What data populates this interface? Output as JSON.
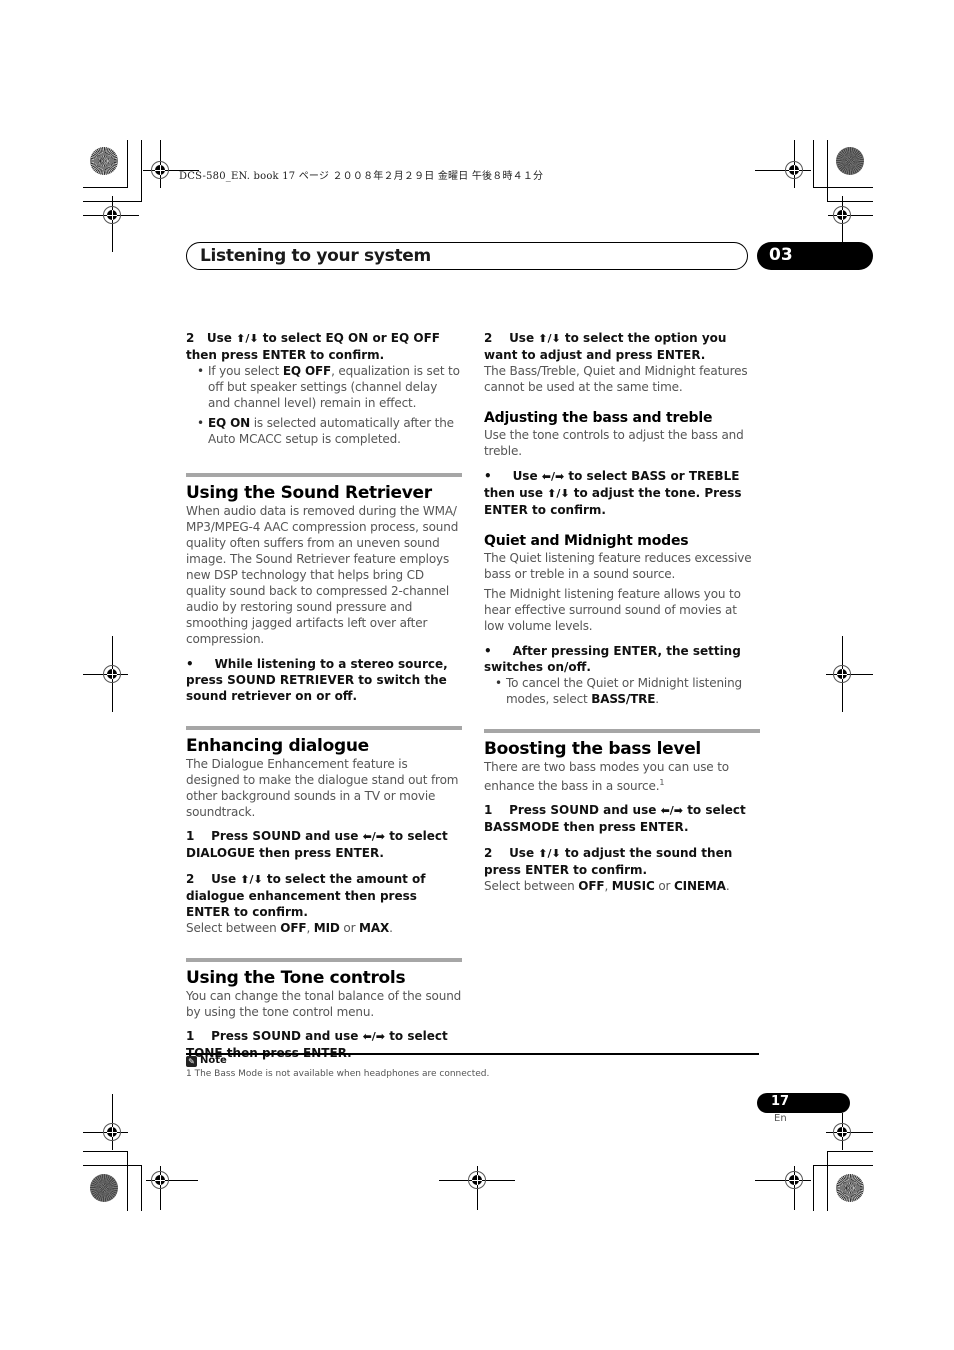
{
  "book_meta": "DCS-580_EN. book   17 ページ   ２００８年２月２９日   金曜日   午後８時４１分",
  "header": {
    "chapter_title": "Listening to your system",
    "chapter_number": "03"
  },
  "left_column": {
    "eq_step": {
      "number": "2",
      "text_a": "Use ",
      "arrows": "⬆/⬇",
      "text_b": " to select EQ ON or EQ OFF then press ENTER to confirm.",
      "bullets": [
        {
          "bold": "EQ OFF",
          "pre": "If you select ",
          "post": ", equalization is set to off but speaker settings (channel delay and channel level) remain in effect."
        },
        {
          "bold": "EQ ON",
          "pre": "",
          "post": " is selected automatically after the Auto MCACC setup is completed."
        }
      ]
    },
    "sound_retriever": {
      "heading": "Using the Sound Retriever",
      "body": "When audio data is removed during the WMA/ MP3/MPEG-4 AAC compression process, sound quality often suffers from an uneven sound image. The Sound Retriever feature employs new DSP technology that helps bring CD quality sound back to compressed 2-channel audio by restoring sound pressure and smoothing jagged artifacts left over after compression.",
      "bullet": "While listening to a stereo source, press SOUND RETRIEVER to switch the sound retriever on or off."
    },
    "dialogue": {
      "heading": "Enhancing dialogue",
      "body": "The Dialogue Enhancement feature is designed to make the dialogue stand out from other background sounds in a TV or movie soundtrack.",
      "step1_a": "Press SOUND and use ",
      "step1_arrows": "⬅/➡",
      "step1_b": " to select DIALOGUE then press ENTER.",
      "step2_a": "Use ",
      "step2_arrows": "⬆/⬇",
      "step2_b": " to select the amount of dialogue enhancement then press ENTER to confirm.",
      "select_pre": "Select between ",
      "options": [
        "OFF",
        "MID",
        "MAX"
      ],
      "sep1": ", ",
      "sep2": " or ",
      "end": "."
    },
    "tone": {
      "heading": "Using the Tone controls",
      "body": "You can change the tonal balance of the sound by using the tone control menu.",
      "step1_a": "Press SOUND and use ",
      "step1_arrows": "⬅/➡",
      "step1_b": " to select TONE then press ENTER."
    }
  },
  "right_column": {
    "tone_step2": {
      "a": "Use ",
      "arrows": "⬆/⬇",
      "b": " to select the option you want to adjust and press ENTER.",
      "body": "The Bass/Treble, Quiet and Midnight features cannot be used at the same time."
    },
    "bass_treble": {
      "heading": "Adjusting the bass and treble",
      "body": "Use the tone controls to adjust the bass and treble.",
      "bullet_a": "Use ",
      "bullet_arrows1": "⬅/➡",
      "bullet_b": " to select BASS or TREBLE then use ",
      "bullet_arrows2": "⬆/⬇",
      "bullet_c": " to adjust the tone. Press ENTER to confirm."
    },
    "quiet_midnight": {
      "heading": "Quiet and Midnight modes",
      "body1": "The Quiet listening feature reduces excessive bass or treble in a sound source.",
      "body2": "The Midnight listening feature allows you to hear effective surround sound of movies at low volume levels.",
      "bullet": "After pressing ENTER, the setting switches on/off.",
      "sub_pre": "To cancel the Quiet or Midnight listening modes, select ",
      "sub_bold": "BASS/TRE",
      "sub_post": "."
    },
    "bass_boost": {
      "heading": "Boosting the bass level",
      "body": "There are two bass modes you can use to enhance the bass in a source.",
      "footnote_ref": "1",
      "step1_a": "Press SOUND and use ",
      "step1_arrows": "⬅/➡",
      "step1_b": " to select BASSMODE then press ENTER.",
      "step2_a": "Use ",
      "step2_arrows": "⬆/⬇",
      "step2_b": " to adjust the sound then press ENTER to confirm.",
      "select_pre": "Select between ",
      "options": [
        "OFF",
        "MUSIC",
        "CINEMA"
      ],
      "sep1": ", ",
      "sep2": " or ",
      "end": "."
    }
  },
  "note": {
    "label": "Note",
    "text": "1 The Bass Mode is not available when headphones are connected."
  },
  "footer": {
    "page_number": "17",
    "language": "En"
  }
}
